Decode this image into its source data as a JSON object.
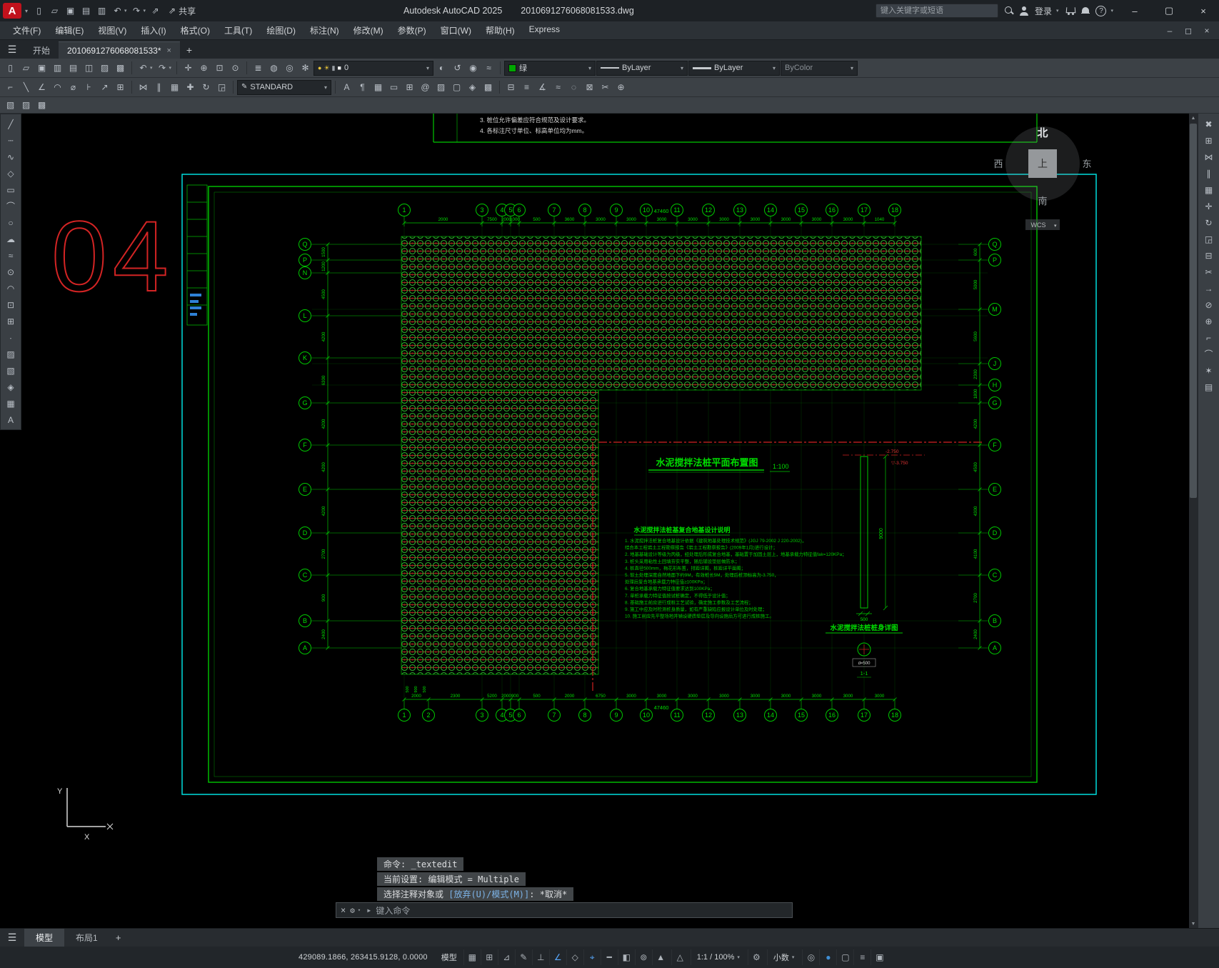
{
  "glyphs": {
    "caret": "▾",
    "close": "×",
    "add": "+",
    "hamburger": "☰",
    "min": "–",
    "max": "▢",
    "restore": "◻",
    "scroll_up": "▲",
    "scroll_down": "▼"
  },
  "titlebar": {
    "logo_letter": "A",
    "app_title": "Autodesk AutoCAD 2025",
    "doc_title": "2010691276068081533.dwg",
    "share_label": "共享",
    "search_placeholder": "键入关键字或短语",
    "login_label": "登录",
    "qat_icons": [
      {
        "name": "qnew-icon",
        "glyph": "▯"
      },
      {
        "name": "open-icon",
        "glyph": "▱"
      },
      {
        "name": "save-icon",
        "glyph": "▣"
      },
      {
        "name": "saveas-icon",
        "glyph": "▤"
      },
      {
        "name": "plot-icon",
        "glyph": "▥"
      },
      {
        "name": "undo-icon",
        "glyph": "↶",
        "caret": true
      },
      {
        "name": "redo-icon",
        "glyph": "↷",
        "caret": true
      },
      {
        "name": "share-icon",
        "glyph": "⇗"
      }
    ]
  },
  "menubar": {
    "items": [
      "文件(F)",
      "编辑(E)",
      "视图(V)",
      "插入(I)",
      "格式(O)",
      "工具(T)",
      "绘图(D)",
      "标注(N)",
      "修改(M)",
      "参数(P)",
      "窗口(W)",
      "帮助(H)",
      "Express"
    ]
  },
  "filetabs": {
    "start_label": "开始",
    "doc_label": "2010691276068081533*"
  },
  "ribbon1": {
    "file_icons": [
      {
        "name": "new-icon",
        "glyph": "▯"
      },
      {
        "name": "open-icon",
        "glyph": "▱"
      },
      {
        "name": "save-icon",
        "glyph": "▣"
      },
      {
        "name": "plot-icon",
        "glyph": "▥"
      },
      {
        "name": "publish-icon",
        "glyph": "▤"
      },
      {
        "name": "preview-icon",
        "glyph": "◫"
      },
      {
        "name": "copy-clip-icon",
        "glyph": "▨"
      },
      {
        "name": "paste-clip-icon",
        "glyph": "▩"
      }
    ],
    "edit_icons": [
      {
        "name": "undo-icon",
        "glyph": "↶",
        "caret": true
      },
      {
        "name": "redo-icon",
        "glyph": "↷",
        "caret": true
      }
    ],
    "nav_icons": [
      {
        "name": "pan-icon",
        "glyph": "✛"
      },
      {
        "name": "zoom-realtime-icon",
        "glyph": "⊕"
      },
      {
        "name": "zoom-window-icon",
        "glyph": "⊡"
      },
      {
        "name": "zoom-previous-icon",
        "glyph": "⊙"
      }
    ],
    "layer_tool_icons": [
      {
        "name": "layer-properties-icon",
        "glyph": "≣"
      },
      {
        "name": "layer-off-icon",
        "glyph": "◍"
      },
      {
        "name": "layer-isolate-icon",
        "glyph": "◎"
      },
      {
        "name": "layer-freeze-icon",
        "glyph": "✻"
      }
    ],
    "layer_combo": {
      "value": "0",
      "icons": [
        {
          "name": "layer-on-icon",
          "glyph": "●",
          "color": "#e9c53a"
        },
        {
          "name": "layer-sun-icon",
          "glyph": "☀",
          "color": "#e9c53a"
        },
        {
          "name": "layer-lock-icon",
          "glyph": "▮",
          "color": "#9aa0a6"
        },
        {
          "name": "layer-color-swatch",
          "glyph": "■",
          "color": "#f0f0f0"
        }
      ]
    },
    "layer_state_icons": [
      {
        "name": "layer-state-icon",
        "glyph": "◐"
      },
      {
        "name": "layer-previous-icon",
        "glyph": "↺"
      },
      {
        "name": "layer-walk-icon",
        "glyph": "◉"
      },
      {
        "name": "layer-match-icon",
        "glyph": "≈"
      }
    ],
    "color_combo": {
      "label": "绿",
      "swatch": "#00a800"
    },
    "linetype_combo": {
      "label": "ByLayer"
    },
    "lineweight_combo": {
      "label": "ByLayer"
    },
    "plotstyle_combo": {
      "label": "ByColor"
    }
  },
  "ribbon2": {
    "group_a": [
      {
        "name": "dim-linear-icon",
        "glyph": "⌐"
      },
      {
        "name": "dim-aligned-icon",
        "glyph": "╲"
      },
      {
        "name": "dim-angular-icon",
        "glyph": "∠"
      },
      {
        "name": "dim-arc-icon",
        "glyph": "◠"
      },
      {
        "name": "dim-diameter-icon",
        "glyph": "⌀"
      },
      {
        "name": "dim-continue-icon",
        "glyph": "⊦"
      },
      {
        "name": "leader-icon",
        "glyph": "↗"
      },
      {
        "name": "tolerance-icon",
        "glyph": "⊞"
      }
    ],
    "group_b": [
      {
        "name": "mirror-icon",
        "glyph": "⋈"
      },
      {
        "name": "offset-icon",
        "glyph": "∥"
      },
      {
        "name": "array-icon",
        "glyph": "▦"
      },
      {
        "name": "move-icon",
        "glyph": "✚"
      },
      {
        "name": "rotate-icon",
        "glyph": "↻"
      },
      {
        "name": "scale-icon",
        "glyph": "◲"
      }
    ],
    "text_style": {
      "icon_glyph": "✎",
      "value": "STANDARD"
    },
    "group_c": [
      {
        "name": "text-icon",
        "glyph": "A"
      },
      {
        "name": "mtext-icon",
        "glyph": "¶"
      },
      {
        "name": "table-icon",
        "glyph": "▦"
      },
      {
        "name": "field-icon",
        "glyph": "▭"
      },
      {
        "name": "block-icon",
        "glyph": "⊞"
      },
      {
        "name": "attribute-icon",
        "glyph": "@"
      },
      {
        "name": "hatch-icon",
        "glyph": "▨"
      },
      {
        "name": "boundary-icon",
        "glyph": "▢"
      },
      {
        "name": "region-icon",
        "glyph": "◈"
      },
      {
        "name": "wipeout-icon",
        "glyph": "▩"
      }
    ],
    "group_d": [
      {
        "name": "measure-icon",
        "glyph": "⊟"
      },
      {
        "name": "list-icon",
        "glyph": "≡"
      },
      {
        "name": "angle-icon",
        "glyph": "∡"
      },
      {
        "name": "spline-edit-icon",
        "glyph": "≈"
      },
      {
        "name": "point-style-icon",
        "glyph": "◌"
      },
      {
        "name": "break-icon",
        "glyph": "⊠"
      },
      {
        "name": "trim-icon",
        "glyph": "✂"
      },
      {
        "name": "join-icon",
        "glyph": "⊕"
      }
    ]
  },
  "ribbon3": {
    "icons": [
      {
        "name": "refedit-icon",
        "glyph": "▧"
      },
      {
        "name": "xref-icon",
        "glyph": "▨"
      },
      {
        "name": "image-attach-icon",
        "glyph": "▩"
      }
    ]
  },
  "left_toolbar": [
    {
      "name": "line-icon",
      "glyph": "╱"
    },
    {
      "name": "construction-line-icon",
      "glyph": "┄"
    },
    {
      "name": "polyline-icon",
      "glyph": "∿"
    },
    {
      "name": "polygon-icon",
      "glyph": "◇"
    },
    {
      "name": "rectangle-icon",
      "glyph": "▭"
    },
    {
      "name": "arc-icon",
      "glyph": "⌒"
    },
    {
      "name": "circle-icon",
      "glyph": "○"
    },
    {
      "name": "revision-cloud-icon",
      "glyph": "☁"
    },
    {
      "name": "spline-icon",
      "glyph": "≈"
    },
    {
      "name": "ellipse-icon",
      "glyph": "⊙"
    },
    {
      "name": "ellipse-arc-icon",
      "glyph": "◠"
    },
    {
      "name": "insert-block-icon",
      "glyph": "⊡"
    },
    {
      "name": "make-block-icon",
      "glyph": "⊞"
    },
    {
      "name": "point-icon",
      "glyph": "∙"
    },
    {
      "name": "hatch-icon",
      "glyph": "▨"
    },
    {
      "name": "gradient-icon",
      "glyph": "▧"
    },
    {
      "name": "region-icon",
      "glyph": "◈"
    },
    {
      "name": "table-icon",
      "glyph": "▦"
    },
    {
      "name": "mtext-icon",
      "glyph": "A"
    }
  ],
  "right_toolbar": [
    {
      "name": "erase-icon",
      "glyph": "✖"
    },
    {
      "name": "copy-icon",
      "glyph": "⊞"
    },
    {
      "name": "mirror-icon",
      "glyph": "⋈"
    },
    {
      "name": "offset-icon",
      "glyph": "∥"
    },
    {
      "name": "array-icon",
      "glyph": "▦"
    },
    {
      "name": "move-icon",
      "glyph": "✛"
    },
    {
      "name": "rotate-icon",
      "glyph": "↻"
    },
    {
      "name": "scale-icon",
      "glyph": "◲"
    },
    {
      "name": "stretch-icon",
      "glyph": "⊟"
    },
    {
      "name": "trim-icon",
      "glyph": "✂"
    },
    {
      "name": "extend-icon",
      "glyph": "→"
    },
    {
      "name": "break-icon",
      "glyph": "⊘"
    },
    {
      "name": "join-icon",
      "glyph": "⊕"
    },
    {
      "name": "chamfer-icon",
      "glyph": "⌐"
    },
    {
      "name": "fillet-icon",
      "glyph": "⌒"
    },
    {
      "name": "explode-icon",
      "glyph": "✶"
    },
    {
      "name": "properties-icon",
      "glyph": "▤"
    }
  ],
  "drawing": {
    "sheet_number": "04",
    "frame_notes": [
      "3. 桩位允许偏差应符合规范及设计要求。",
      "4. 各标注尺寸单位、标高单位均为mm。"
    ],
    "plan_title": "水泥搅拌法桩平面布置图",
    "plan_scale": "1:100",
    "total_dim_top": "47460",
    "total_dim_bottom": "47460",
    "axis_top": [
      "1",
      "3",
      "4",
      "5",
      "6",
      "7",
      "8",
      "9",
      "10",
      "11",
      "12",
      "13",
      "14",
      "15",
      "16",
      "17",
      "18"
    ],
    "axis_bottom": [
      "1",
      "2",
      "3",
      "4",
      "5",
      "6",
      "7",
      "8",
      "9",
      "10",
      "11",
      "12",
      "13",
      "14",
      "15",
      "16",
      "17",
      "18"
    ],
    "axis_left": [
      "Q",
      "P",
      "N",
      "L",
      "K",
      "G",
      "F",
      "E",
      "D",
      "C",
      "B",
      "A"
    ],
    "axis_right": [
      "Q",
      "P",
      "M",
      "J",
      "H",
      "G",
      "F",
      "E",
      "D",
      "C",
      "B",
      "A"
    ],
    "dims_top": [
      "2000",
      "7500",
      "2000",
      "1000",
      "500",
      "3600",
      "3000",
      "3000",
      "3000",
      "3000",
      "3000",
      "3000",
      "3000",
      "3000",
      "3000",
      "1040"
    ],
    "dims_bottom": [
      "2000",
      "2300",
      "5200",
      "2000",
      "900",
      "500",
      "2000",
      "6750",
      "3000",
      "3000",
      "3000",
      "3000",
      "3000",
      "3000",
      "3000",
      "3000",
      "3000"
    ],
    "dims_left": [
      "1500",
      "1200",
      "4500",
      "4200",
      "6300",
      "4200",
      "4200",
      "4200",
      "2700",
      "900",
      "2400"
    ],
    "dims_right": [
      "600",
      "5000",
      "5600",
      "2300",
      "1800",
      "4200",
      "4500",
      "4300",
      "4100",
      "2700",
      "2400"
    ],
    "dims_bottom_sub": [
      "500",
      "900",
      "500"
    ],
    "notes_title": "水泥搅拌法桩基复合地基设计说明",
    "notes": [
      "1. 水泥搅拌法桩复合地基设计依据《建筑地基处理技术规范》(JGJ 79-2002 J 220-2002)，",
      "   结合本工程岩土工程勘察报告《岩土工程勘察报告》(2009年1月)进行设计；",
      "2. 地基基础设计等级为丙级，经处理后形成复合地基，基础置于加固土层上，地基承载力特征值fak=120KPa；",
      "3. 桩头采用粘性土回填夯实平整，随后铺设垫层做防水；",
      "4. 桩直径500mm，梅花形布置，排距详图，桩距详平面图；",
      "5. 软土处理深度自然地面下约9M，有效桩长5M，处理后桩顶标高为-3.750，",
      "   处理后复合地基承载力特征值≥100KPa；",
      "6. 复合地基承载力特征值要求达到100KPa；",
      "7. 单桩承载力特征值按试桩确定，不得低于设计值；",
      "8. 基础施工前应进行成桩工艺试验，确定施工参数及工艺流程；",
      "9. 施工中应及时检测桩身质量，如有严重缺陷应报设计单位及时处理；",
      "10. 施工前应先平整场地并铺设硬质垫层及导向设施后方可进行成桩施工。"
    ],
    "detail_title": "水泥搅拌法桩桩身详图",
    "detail": {
      "level_top": "-2.750",
      "level_bottom": "▽-3.750",
      "width_dim": "500",
      "length_dim": "9000",
      "section_label": "1-1",
      "section_note": "d=500"
    },
    "viewcube": {
      "north": "北",
      "south": "南",
      "west": "西",
      "east": "东",
      "top": "上",
      "wcs": "WCS"
    },
    "ucs": {
      "x_label": "X",
      "y_label": "Y"
    }
  },
  "command": {
    "line1": "命令: _textedit",
    "line2": "当前设置: 编辑模式 = Multiple",
    "line3_pre": "选择注释对象或 ",
    "line3_options": "[放弃(U)/模式(M)]",
    "line3_post": ": *取消*",
    "prompt": "键入命令",
    "close_glyph": "×",
    "tools_glyph": "⚙",
    "prompt_icon": "▸"
  },
  "doctabs": {
    "model": "模型",
    "layout": "布局1"
  },
  "statusbar": {
    "coords": "429089.1866, 263415.9128, 0.0000",
    "model_label": "模型",
    "left_icons": [
      {
        "name": "grid-icon",
        "glyph": "▦"
      },
      {
        "name": "snap-icon",
        "glyph": "⊞"
      },
      {
        "name": "infer-constraints-icon",
        "glyph": "⊿"
      },
      {
        "name": "dynamic-input-icon",
        "glyph": "✎"
      },
      {
        "name": "ortho-icon",
        "glyph": "⊥"
      },
      {
        "name": "polar-tracking-icon",
        "glyph": "∠",
        "active": true
      },
      {
        "name": "isodraft-icon",
        "glyph": "◇"
      },
      {
        "name": "osnap-icon",
        "glyph": "⌖",
        "active": true
      },
      {
        "name": "lineweight-icon",
        "glyph": "━"
      },
      {
        "name": "transparency-icon",
        "glyph": "◧"
      },
      {
        "name": "selection-cycling-icon",
        "glyph": "⊚"
      },
      {
        "name": "annotation-monitor-icon",
        "glyph": "▲"
      }
    ],
    "scale_label": "1:1 / 100%",
    "units_label": "小数",
    "right_icons_a": [
      {
        "name": "annotation-scale-icon",
        "glyph": "△"
      }
    ],
    "right_icons_b": [
      {
        "name": "workspace-switching-icon",
        "glyph": "⚙"
      }
    ],
    "right_icons_c": [
      {
        "name": "object-isolate-icon",
        "glyph": "◎"
      },
      {
        "name": "hardware-acceleration-icon",
        "glyph": "●",
        "color": "#3f8fd6"
      },
      {
        "name": "clean-screen-icon",
        "glyph": "▢"
      },
      {
        "name": "customization-icon",
        "glyph": "≡"
      },
      {
        "name": "lock-ui-icon",
        "glyph": "▣"
      }
    ]
  }
}
